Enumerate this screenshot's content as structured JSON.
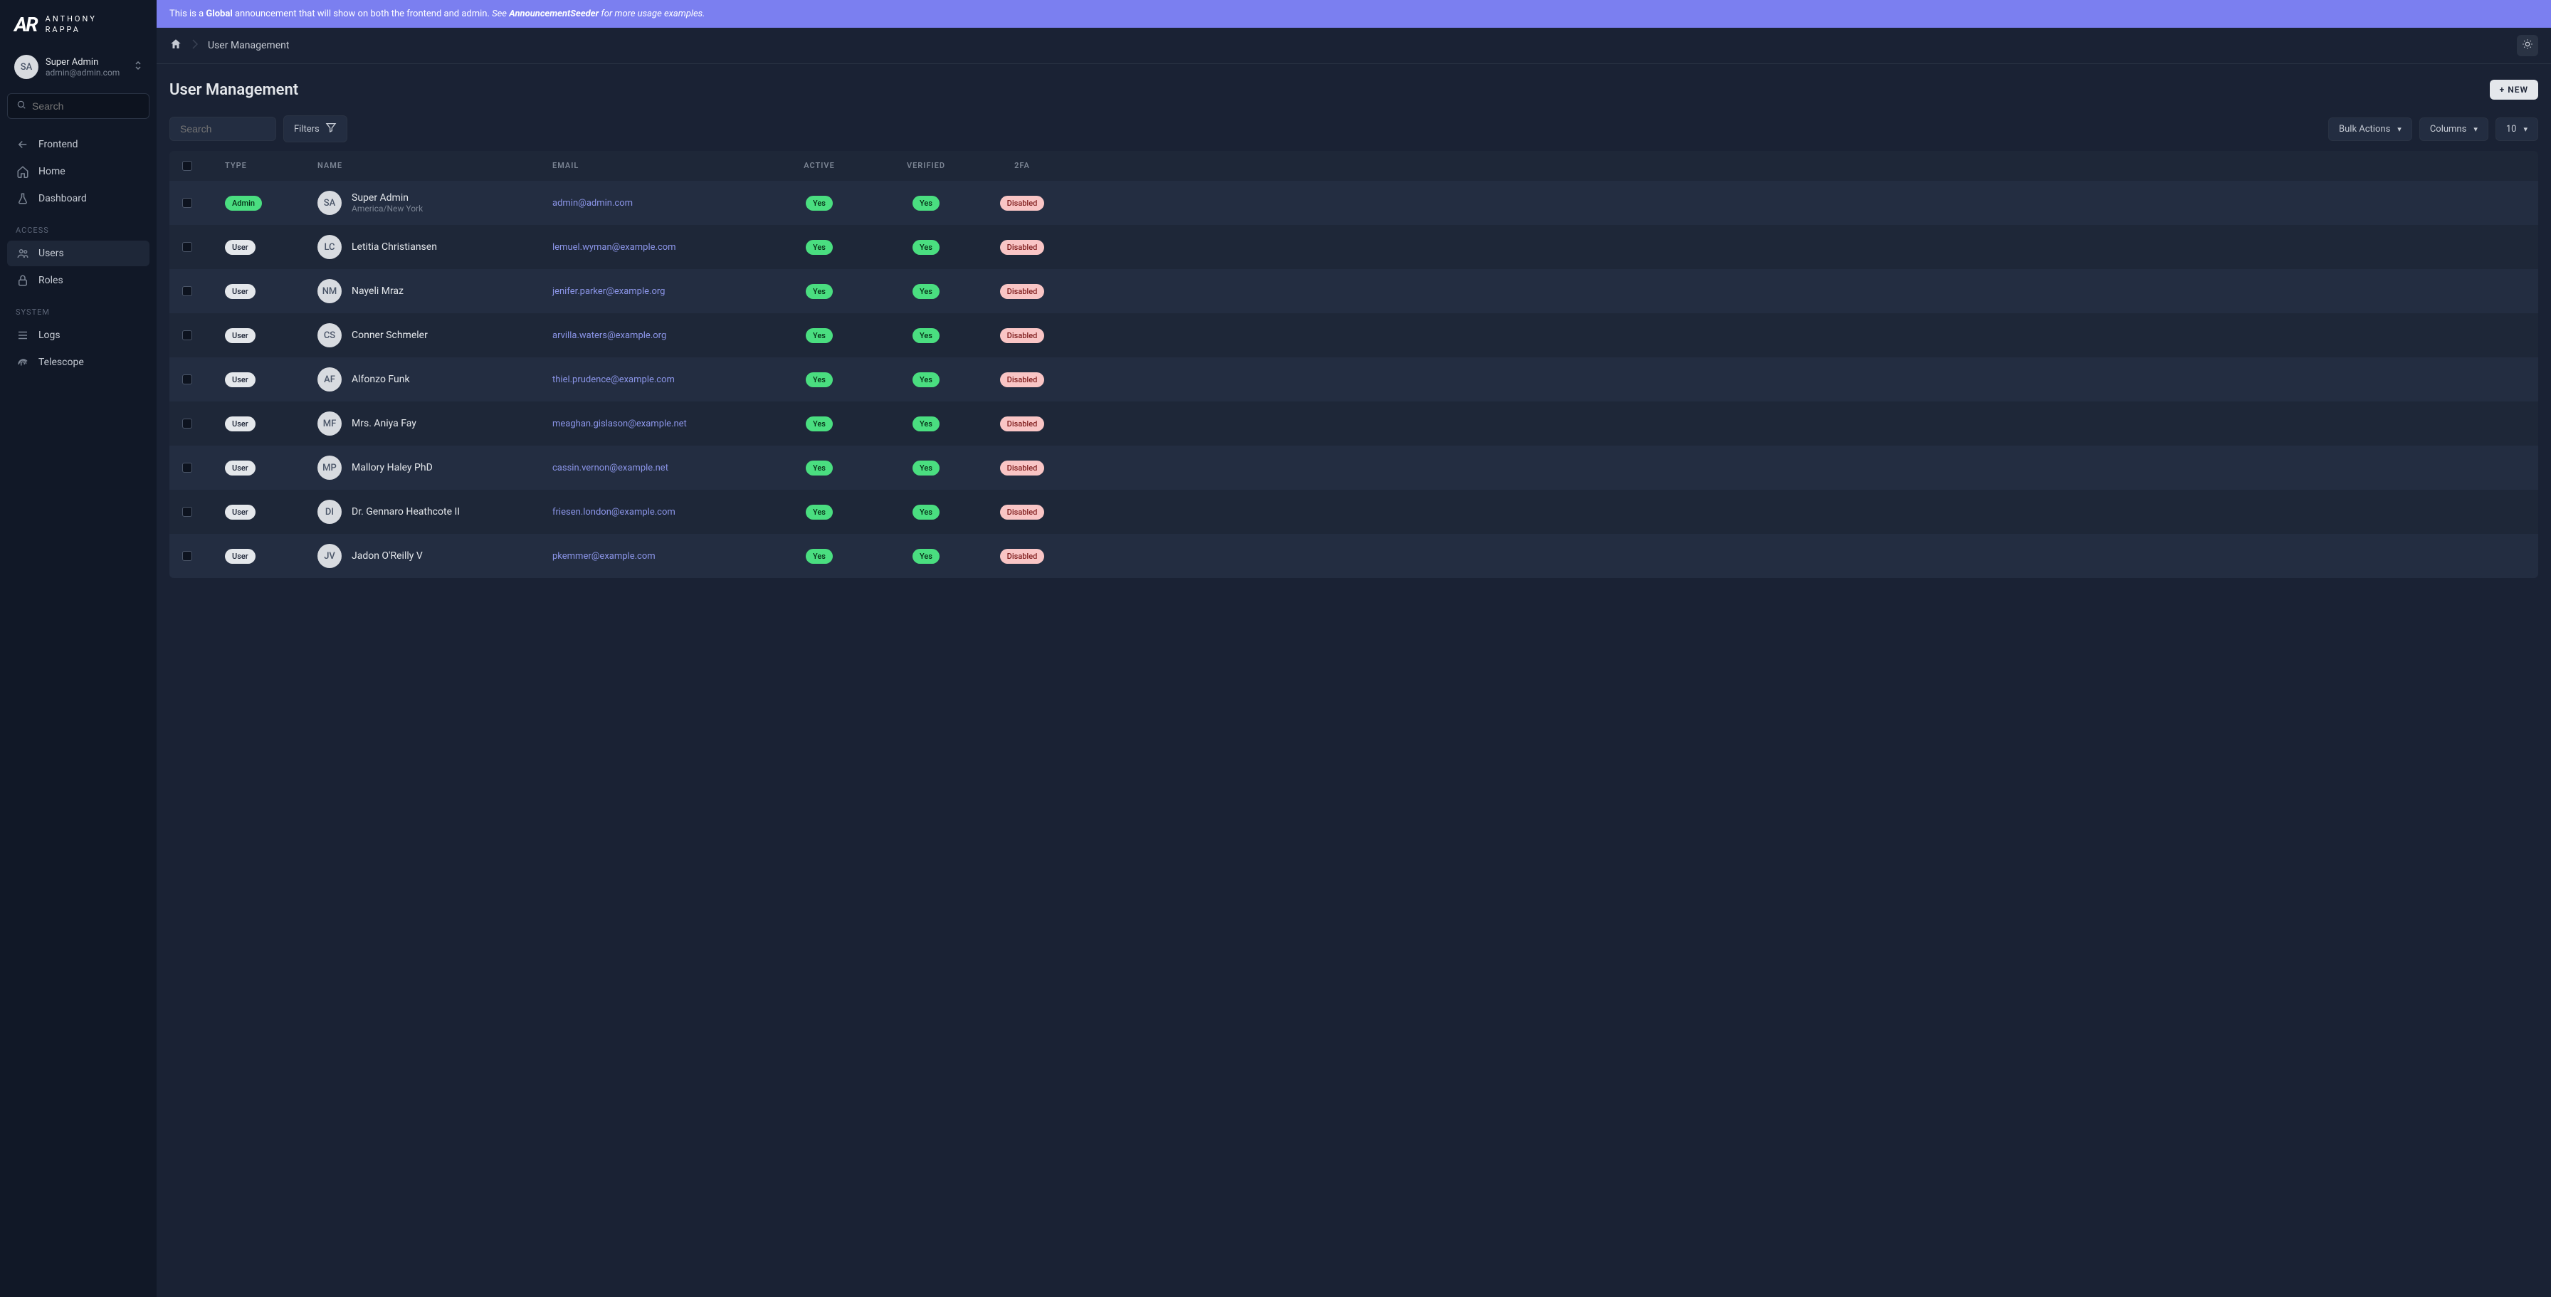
{
  "logo": {
    "mark": "AR",
    "line1": "ANTHONY",
    "line2": "RAPPA"
  },
  "current_user": {
    "initials": "SA",
    "name": "Super Admin",
    "email": "admin@admin.com"
  },
  "sidebar": {
    "search_placeholder": "Search",
    "main": [
      {
        "label": "Frontend",
        "icon": "arrow-left"
      },
      {
        "label": "Home",
        "icon": "home"
      },
      {
        "label": "Dashboard",
        "icon": "flask"
      }
    ],
    "access_header": "ACCESS",
    "access": [
      {
        "label": "Users",
        "icon": "users",
        "active": true
      },
      {
        "label": "Roles",
        "icon": "lock"
      }
    ],
    "system_header": "SYSTEM",
    "system": [
      {
        "label": "Logs",
        "icon": "list"
      },
      {
        "label": "Telescope",
        "icon": "fingerprint"
      }
    ]
  },
  "announcement": {
    "pre": "This is a ",
    "bold1": "Global",
    "mid": " announcement that will show on both the frontend and admin. ",
    "see": "See ",
    "bold2": "AnnouncementSeeder",
    "tail": " for more usage examples."
  },
  "breadcrumb": {
    "current": "User Management"
  },
  "page": {
    "title": "User Management",
    "new_btn": "+ NEW"
  },
  "toolbar": {
    "search_placeholder": "Search",
    "filters": "Filters",
    "bulk": "Bulk Actions",
    "columns": "Columns",
    "perpage": "10"
  },
  "columns": {
    "type": "TYPE",
    "name": "NAME",
    "email": "EMAIL",
    "active": "ACTIVE",
    "verified": "VERIFIED",
    "twofa": "2FA"
  },
  "badges": {
    "admin": "Admin",
    "user": "User",
    "yes": "Yes",
    "disabled": "Disabled"
  },
  "rows": [
    {
      "type": "admin",
      "initials": "SA",
      "name": "Super Admin",
      "sub": "America/New York",
      "email": "admin@admin.com",
      "active": "Yes",
      "verified": "Yes",
      "twofa": "Disabled"
    },
    {
      "type": "user",
      "initials": "LC",
      "name": "Letitia Christiansen",
      "sub": "",
      "email": "lemuel.wyman@example.com",
      "active": "Yes",
      "verified": "Yes",
      "twofa": "Disabled"
    },
    {
      "type": "user",
      "initials": "NM",
      "name": "Nayeli Mraz",
      "sub": "",
      "email": "jenifer.parker@example.org",
      "active": "Yes",
      "verified": "Yes",
      "twofa": "Disabled"
    },
    {
      "type": "user",
      "initials": "CS",
      "name": "Conner Schmeler",
      "sub": "",
      "email": "arvilla.waters@example.org",
      "active": "Yes",
      "verified": "Yes",
      "twofa": "Disabled"
    },
    {
      "type": "user",
      "initials": "AF",
      "name": "Alfonzo Funk",
      "sub": "",
      "email": "thiel.prudence@example.com",
      "active": "Yes",
      "verified": "Yes",
      "twofa": "Disabled"
    },
    {
      "type": "user",
      "initials": "MF",
      "name": "Mrs. Aniya Fay",
      "sub": "",
      "email": "meaghan.gislason@example.net",
      "active": "Yes",
      "verified": "Yes",
      "twofa": "Disabled"
    },
    {
      "type": "user",
      "initials": "MP",
      "name": "Mallory Haley PhD",
      "sub": "",
      "email": "cassin.vernon@example.net",
      "active": "Yes",
      "verified": "Yes",
      "twofa": "Disabled"
    },
    {
      "type": "user",
      "initials": "DI",
      "name": "Dr. Gennaro Heathcote II",
      "sub": "",
      "email": "friesen.london@example.com",
      "active": "Yes",
      "verified": "Yes",
      "twofa": "Disabled"
    },
    {
      "type": "user",
      "initials": "JV",
      "name": "Jadon O'Reilly V",
      "sub": "",
      "email": "pkemmer@example.com",
      "active": "Yes",
      "verified": "Yes",
      "twofa": "Disabled"
    }
  ]
}
